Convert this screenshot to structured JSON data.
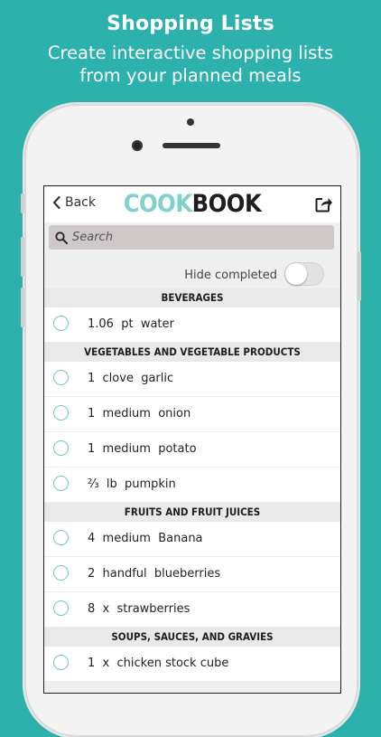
{
  "promo": {
    "title": "Shopping Lists",
    "subtitle_line1": "Create interactive shopping lists",
    "subtitle_line2": "from your planned meals"
  },
  "navbar": {
    "back_label": "Back",
    "logo_part1": "COOK",
    "logo_part2": "BOOK"
  },
  "search": {
    "placeholder": "Search"
  },
  "hide_completed": {
    "label": "Hide completed",
    "enabled": false
  },
  "colors": {
    "accent": "#2db1ac",
    "logo_cook": "#7fd1c9",
    "circle": "#6fc8c1",
    "search_bg": "#cfc8c9"
  },
  "sections": [
    {
      "title": "BEVERAGES",
      "items": [
        "1.06  pt  water"
      ]
    },
    {
      "title": "VEGETABLES AND VEGETABLE PRODUCTS",
      "items": [
        "1  clove  garlic",
        "1  medium  onion",
        "1  medium  potato",
        "⅔  lb  pumpkin"
      ]
    },
    {
      "title": "FRUITS AND FRUIT JUICES",
      "items": [
        "4  medium  Banana",
        "2  handful  blueberries",
        "8  x  strawberries"
      ]
    },
    {
      "title": "SOUPS, SAUCES, AND GRAVIES",
      "items": [
        "1  x  chicken stock cube"
      ]
    }
  ]
}
